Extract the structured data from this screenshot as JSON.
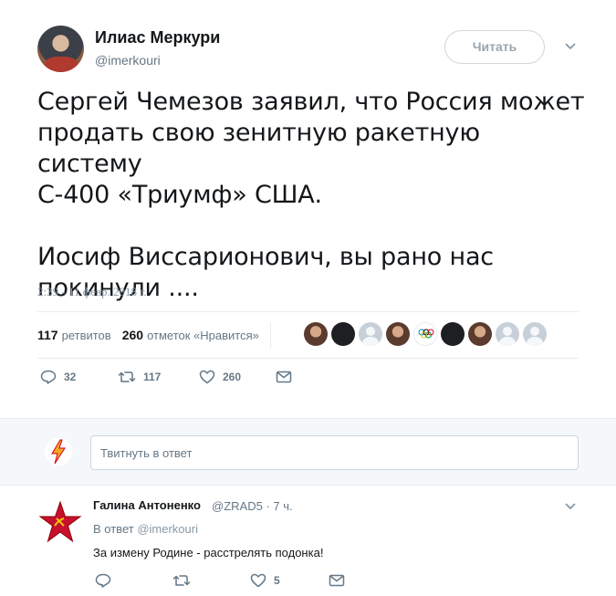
{
  "author": {
    "name": "Илиас Меркури",
    "handle": "@imerkouri"
  },
  "follow_button": "Читать",
  "tweet_text": "Сергей Чемезов заявил, что Россия может\nпродать свою зенитную ракетную систему\nС-400 «Триумф» США.\n\nИосиф Виссарионович, вы рано нас\nпокинули ....",
  "timestamp": "2:39 - 11 февр. 2018 г.",
  "stats": {
    "retweets_count": "117",
    "retweets_label": "ретвитов",
    "likes_count": "260",
    "likes_label": "отметок «Нравится»"
  },
  "liker_avatars": [
    "photo",
    "dark",
    "default",
    "photo",
    "olympic",
    "dark",
    "photo",
    "default",
    "default"
  ],
  "actions": {
    "replies": "32",
    "retweets": "117",
    "likes": "260"
  },
  "reply_box": {
    "placeholder": "Твитнуть в ответ"
  },
  "reply": {
    "name": "Галина Антоненко",
    "handle_time": "@ZRAD5 · 7 ч.",
    "in_reply_prefix": "В ответ",
    "in_reply_handle": "@imerkouri",
    "text": "За измену Родине - расстрелять подонка!",
    "replies": "",
    "retweets": "",
    "likes": "5"
  },
  "colors": {
    "text": "#14171a",
    "secondary": "#657786",
    "divider": "#e6ecf0",
    "reply_bg": "#f5f8fa"
  }
}
